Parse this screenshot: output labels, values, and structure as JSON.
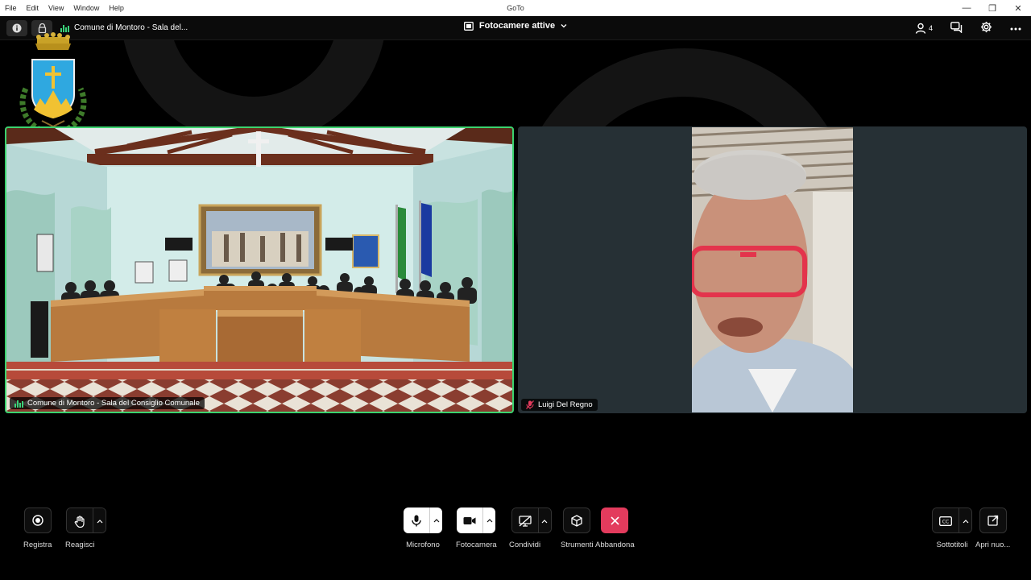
{
  "os": {
    "menu": [
      "File",
      "Edit",
      "View",
      "Window",
      "Help"
    ],
    "title": "GoTo",
    "controls": [
      "—",
      "❐",
      "✕"
    ]
  },
  "toolbar": {
    "meeting_title": "Comune di Montoro - Sala del...",
    "cameras_label": "Fotocamere attive",
    "participants_count": "4"
  },
  "tiles": [
    {
      "label": "Comune di Montoro - Sala del Consiglio Comunale",
      "active_speaker": true
    },
    {
      "label": "Luigi Del Regno",
      "muted": true
    }
  ],
  "controls": {
    "record": "Registra",
    "react": "Reagisci",
    "mic": "Microfono",
    "camera": "Fotocamera",
    "share": "Condividi",
    "tools": "Strumenti",
    "leave": "Abbandona",
    "captions": "Sottotitoli",
    "open_new": "Apri nuo..."
  },
  "colors": {
    "active_border": "#3cd36f",
    "leave": "#e33b5d",
    "tile_bg": "#263035"
  }
}
